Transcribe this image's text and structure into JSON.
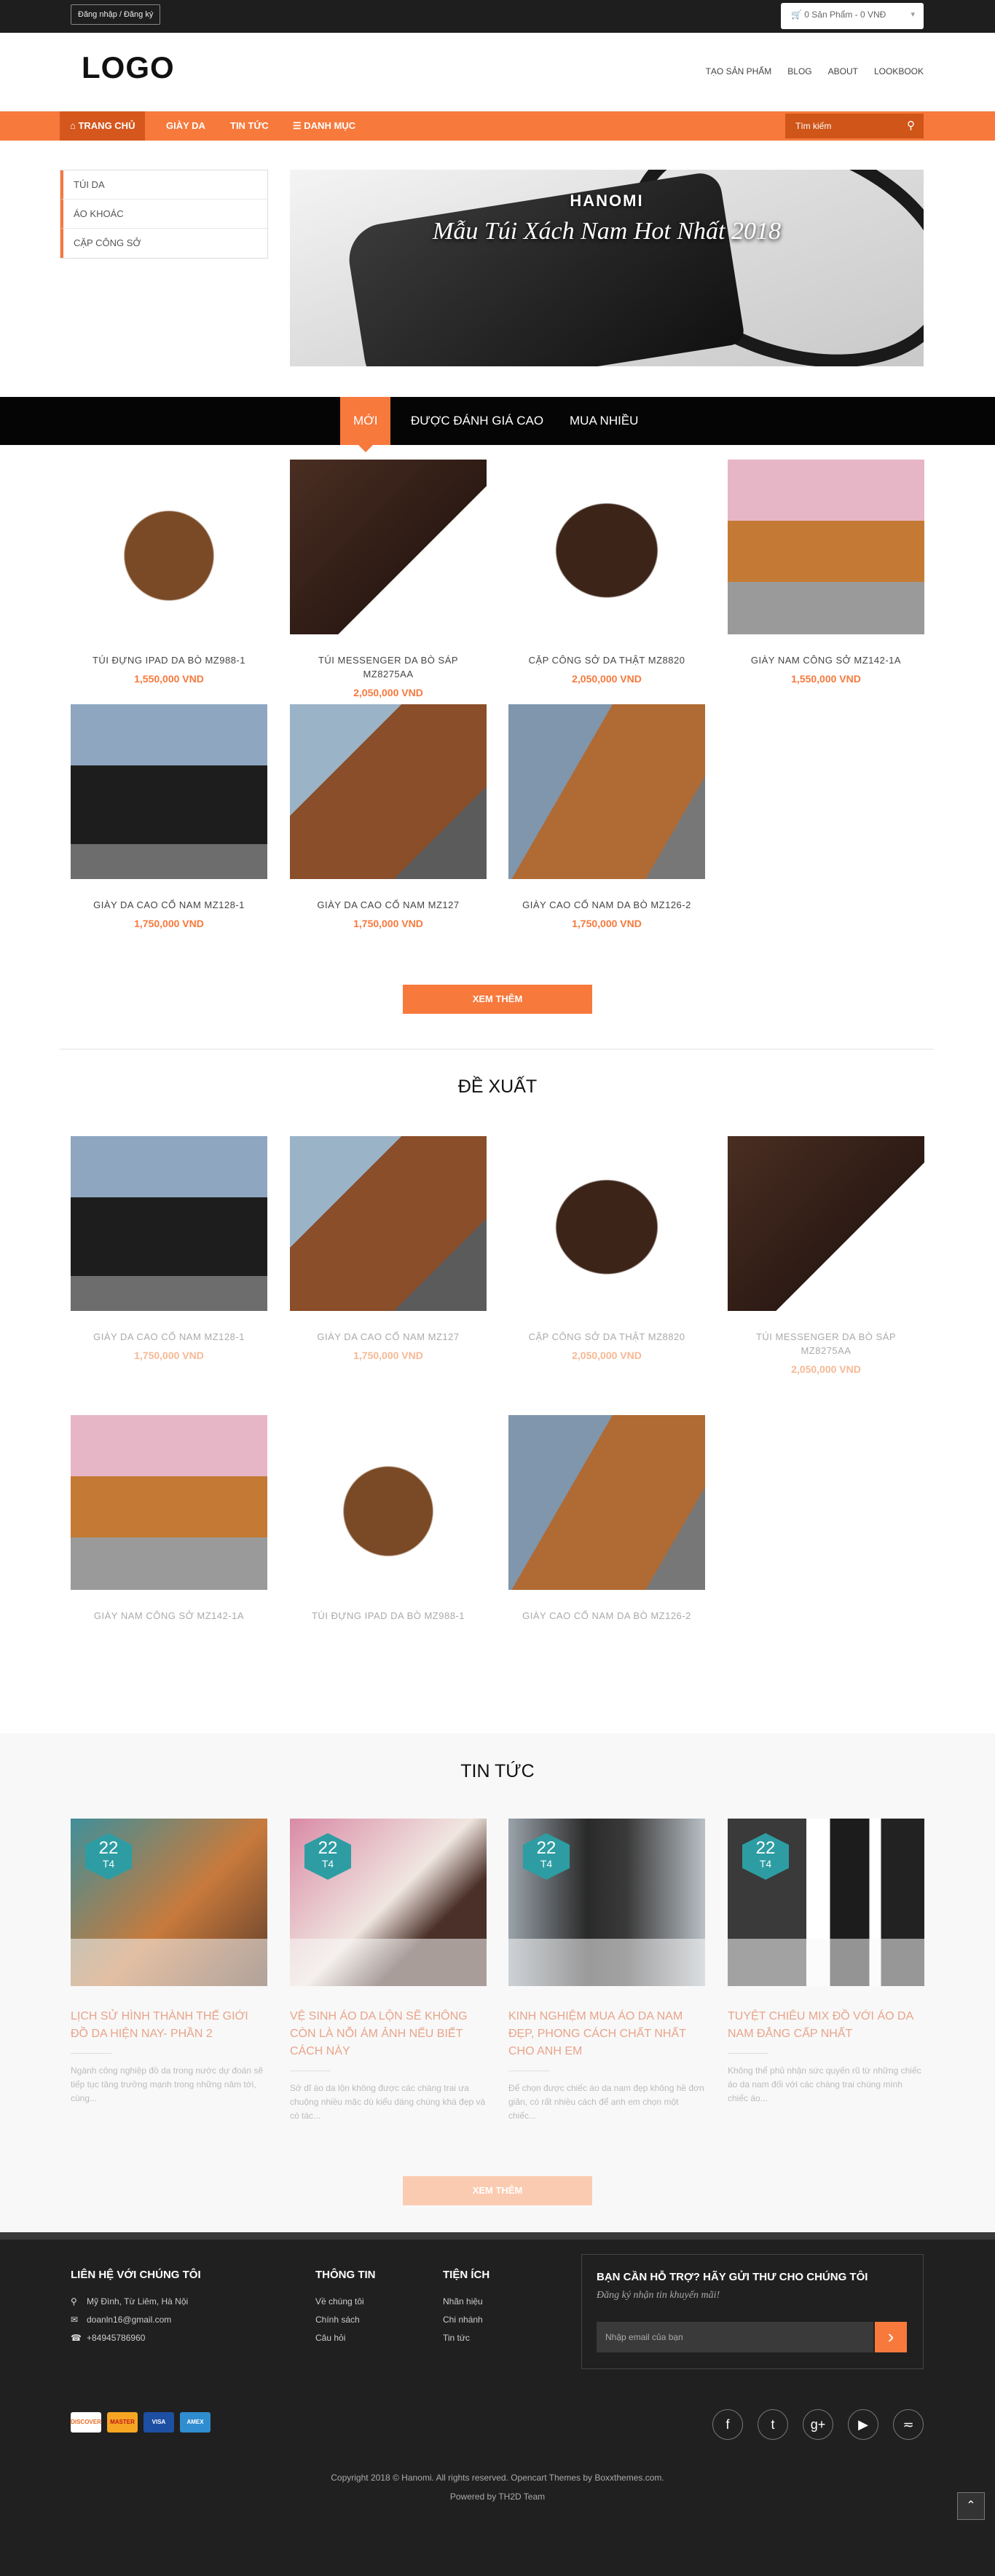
{
  "topbar": {
    "login": "Đăng nhập / Đăng ký",
    "cart": "0 Sản Phẩm - 0 VNĐ"
  },
  "header": {
    "logo": "LOGO",
    "links": [
      "TẠO SẢN PHẨM",
      "BLOG",
      "ABOUT",
      "LOOKBOOK"
    ]
  },
  "nav": {
    "items": [
      "TRANG CHỦ",
      "GIÀY DA",
      "TIN TỨC",
      "DANH MỤC"
    ],
    "search_placeholder": "Tìm kiếm"
  },
  "sidebar": {
    "items": [
      "TÚI DA",
      "ÁO KHOÁC",
      "CẶP CÔNG SỞ"
    ]
  },
  "banner": {
    "brand": "HANOMI",
    "title": "Mẫu Túi Xách Nam Hot Nhất 2018"
  },
  "tabs": [
    "MỚI",
    "ĐƯỢC ĐÁNH GIÁ CAO",
    "MUA NHIỀU"
  ],
  "products": [
    {
      "name": "TÚI ĐỰNG IPAD DA BÒ MZ988-1",
      "price": "1,550,000 VND"
    },
    {
      "name": "TÚI MESSENGER DA BÒ SÁP MZ8275AA",
      "price": "2,050,000 VND"
    },
    {
      "name": "CẶP CÔNG SỞ DA THẬT MZ8820",
      "price": "2,050,000 VND"
    },
    {
      "name": "GIÀY NAM CÔNG SỞ MZ142-1A",
      "price": "1,550,000 VND"
    },
    {
      "name": "GIÀY DA CAO CỔ NAM MZ128-1",
      "price": "1,750,000 VND"
    },
    {
      "name": "GIÀY DA CAO CỔ NAM MZ127",
      "price": "1,750,000 VND"
    },
    {
      "name": "GIÀY CAO CỔ NAM DA BÒ MZ126-2",
      "price": "1,750,000 VND"
    }
  ],
  "more_label": "XEM THÊM",
  "featured": {
    "title": "ĐỀ XUẤT",
    "items": [
      {
        "name": "GIÀY DA CAO CỔ NAM MZ128-1",
        "price": "1,750,000 VND"
      },
      {
        "name": "GIÀY DA CAO CỔ NAM MZ127",
        "price": "1,750,000 VND"
      },
      {
        "name": "CẶP CÔNG SỞ DA THẬT MZ8820",
        "price": "2,050,000 VND"
      },
      {
        "name": "TÚI MESSENGER DA BÒ SÁP MZ8275AA",
        "price": "2,050,000 VND"
      },
      {
        "name": "GIÀY NAM CÔNG SỞ MZ142-1A",
        "price": ""
      },
      {
        "name": "TÚI ĐỰNG IPAD DA BÒ MZ988-1",
        "price": ""
      },
      {
        "name": "GIÀY CAO CỔ NAM DA BÒ MZ126-2",
        "price": ""
      }
    ]
  },
  "news": {
    "title": "TIN TỨC",
    "more_label": "XEM THÊM",
    "items": [
      {
        "day": "22",
        "month": "T4",
        "title": "Lịch sử hình thành thế giới đồ da hiện nay- Phần 2",
        "desc": "Ngành công nghiệp đồ da trong nước dự đoán sẽ tiếp tục tăng trưởng mạnh trong những năm tới, cùng..."
      },
      {
        "day": "22",
        "month": "T4",
        "title": "Vệ sinh áo da lộn sẽ không còn là nỗi ám ảnh nếu biết cách này",
        "desc": "Sở dĩ áo da lộn không được các chàng trai ưa chuộng nhiều mặc dù kiểu dáng chúng khá đẹp và có tác..."
      },
      {
        "day": "22",
        "month": "T4",
        "title": "Kinh nghiệm mua áo da nam đẹp, phong cách chất nhất cho anh em",
        "desc": "Để chọn được chiếc áo da nam đẹp không hề đơn giản, có rất nhiều cách để anh em chọn một chiếc..."
      },
      {
        "day": "22",
        "month": "T4",
        "title": "Tuyệt chiêu mix đồ với áo da nam đẳng cấp nhất",
        "desc": "Không thể phủ nhận sức quyến rũ từ những chiếc áo da nam đối với các chàng trai chúng mình chiếc áo..."
      }
    ]
  },
  "footer": {
    "contact": {
      "title": "LIÊN HỆ VỚI CHÚNG TÔI",
      "address": "Mỹ Đình, Từ Liêm, Hà Nội",
      "email": "doanln16@gmail.com",
      "phone": "+84945786960"
    },
    "info": {
      "title": "THÔNG TIN",
      "items": [
        "Về chúng tôi",
        "Chính sách",
        "Câu hỏi"
      ]
    },
    "util": {
      "title": "TIỆN ÍCH",
      "items": [
        "Nhãn hiệu",
        "Chi nhánh",
        "Tin tức"
      ]
    },
    "newsletter": {
      "title": "BẠN CẦN HỖ TRỢ? HÃY GỬI THƯ CHO CHÚNG TÔI",
      "subtitle": "Đăng ký nhận tin khuyến mãi!",
      "placeholder": "Nhập email của bạn"
    },
    "payments": [
      "DISCOVER",
      "MASTER",
      "VISA",
      "AMEX"
    ],
    "copyright": "Copyright 2018 © Hanomi. All rights reserved. Opencart Themes by Boxxthemes.com.",
    "powered": "Powered by TH2D Team"
  }
}
